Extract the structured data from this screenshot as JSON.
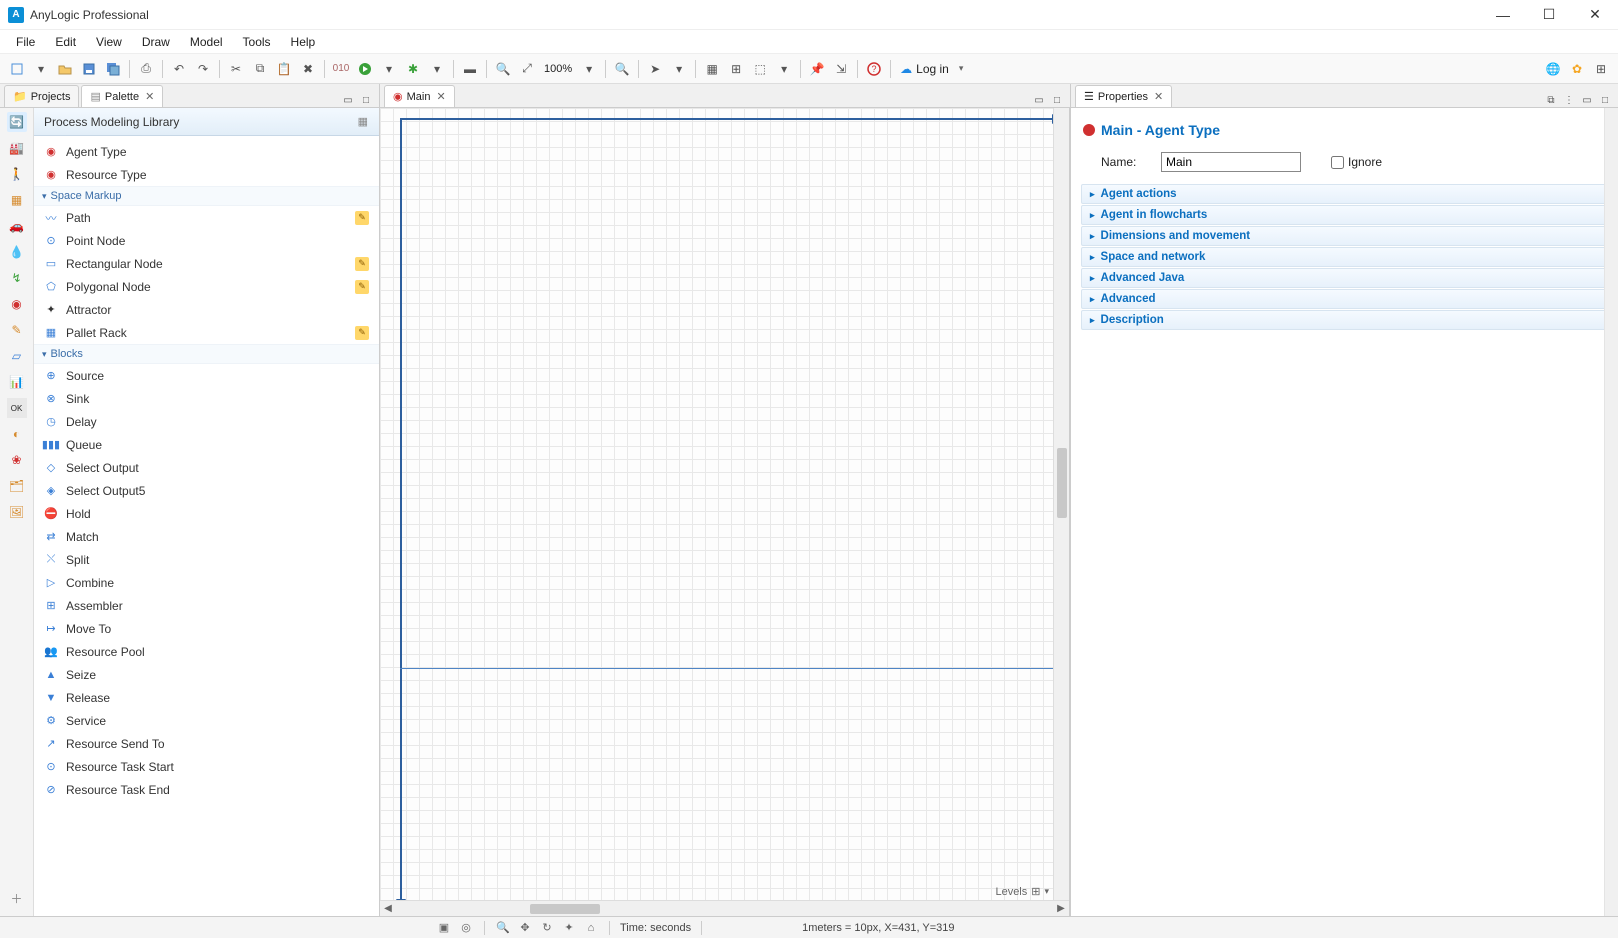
{
  "app": {
    "title": "AnyLogic Professional"
  },
  "menu": [
    "File",
    "Edit",
    "View",
    "Draw",
    "Model",
    "Tools",
    "Help"
  ],
  "toolbar": {
    "zoom": "100%",
    "login": "Log in"
  },
  "left": {
    "tabs": {
      "projects": "Projects",
      "palette": "Palette"
    },
    "palette_header": "Process Modeling Library",
    "top_items": [
      {
        "label": "Agent Type",
        "icon": "◉",
        "color": "#d03030"
      },
      {
        "label": "Resource Type",
        "icon": "◉",
        "color": "#d03030"
      }
    ],
    "group_space": "Space Markup",
    "space_items": [
      {
        "label": "Path",
        "edit": true
      },
      {
        "label": "Point Node",
        "edit": false
      },
      {
        "label": "Rectangular Node",
        "edit": true
      },
      {
        "label": "Polygonal Node",
        "edit": true
      },
      {
        "label": "Attractor",
        "edit": false
      },
      {
        "label": "Pallet Rack",
        "edit": true
      }
    ],
    "group_blocks": "Blocks",
    "block_items": [
      "Source",
      "Sink",
      "Delay",
      "Queue",
      "Select Output",
      "Select Output5",
      "Hold",
      "Match",
      "Split",
      "Combine",
      "Assembler",
      "Move To",
      "Resource Pool",
      "Seize",
      "Release",
      "Service",
      "Resource Send To",
      "Resource Task Start",
      "Resource Task End"
    ]
  },
  "center": {
    "tab": "Main",
    "levels": "Levels"
  },
  "right": {
    "tab": "Properties",
    "title": "Main - Agent Type",
    "name_label": "Name:",
    "name_value": "Main",
    "ignore_label": "Ignore",
    "sections": [
      "Agent actions",
      "Agent in flowcharts",
      "Dimensions and movement",
      "Space and network",
      "Advanced Java",
      "Advanced",
      "Description"
    ]
  },
  "status": {
    "time": "Time: seconds",
    "coords": "1meters = 10px, X=431, Y=319"
  }
}
